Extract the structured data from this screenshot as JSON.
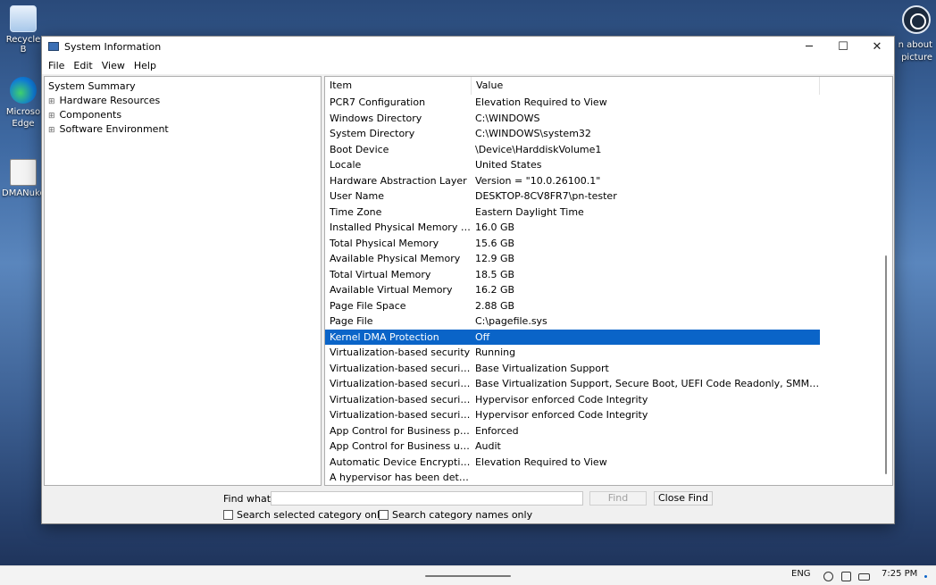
{
  "desktop": {
    "icons": [
      {
        "label": "Recycle B"
      },
      {
        "label": "Microso\nEdge"
      },
      {
        "label": "DMANuke"
      }
    ],
    "spotlight_text": "n about\npicture"
  },
  "window": {
    "title": "System Information",
    "controls": {
      "minimize": "─",
      "maximize": "☐",
      "close": "✕"
    }
  },
  "menu": [
    "File",
    "Edit",
    "View",
    "Help"
  ],
  "tree": [
    {
      "label": "System Summary",
      "expander": ""
    },
    {
      "label": "Hardware Resources",
      "expander": "⊞"
    },
    {
      "label": "Components",
      "expander": "⊞"
    },
    {
      "label": "Software Environment",
      "expander": "⊞"
    }
  ],
  "list": {
    "headers": [
      "Item",
      "Value"
    ],
    "rows": [
      {
        "item": "PCR7 Configuration",
        "value": "Elevation Required to View"
      },
      {
        "item": "Windows Directory",
        "value": "C:\\WINDOWS"
      },
      {
        "item": "System Directory",
        "value": "C:\\WINDOWS\\system32"
      },
      {
        "item": "Boot Device",
        "value": "\\Device\\HarddiskVolume1"
      },
      {
        "item": "Locale",
        "value": "United States"
      },
      {
        "item": "Hardware Abstraction Layer",
        "value": "Version = \"10.0.26100.1\""
      },
      {
        "item": "User Name",
        "value": "DESKTOP-8CV8FR7\\pn-tester"
      },
      {
        "item": "Time Zone",
        "value": "Eastern Daylight Time"
      },
      {
        "item": "Installed Physical Memory (RAM)",
        "value": "16.0 GB"
      },
      {
        "item": "Total Physical Memory",
        "value": "15.6 GB"
      },
      {
        "item": "Available Physical Memory",
        "value": "12.9 GB"
      },
      {
        "item": "Total Virtual Memory",
        "value": "18.5 GB"
      },
      {
        "item": "Available Virtual Memory",
        "value": "16.2 GB"
      },
      {
        "item": "Page File Space",
        "value": "2.88 GB"
      },
      {
        "item": "Page File",
        "value": "C:\\pagefile.sys"
      },
      {
        "item": "Kernel DMA Protection",
        "value": "Off"
      },
      {
        "item": "Virtualization-based security",
        "value": "Running"
      },
      {
        "item": "Virtualization-based security Re...",
        "value": "Base Virtualization Support"
      },
      {
        "item": "Virtualization-based security Av...",
        "value": "Base Virtualization Support, Secure Boot, UEFI Code Readonly, SMM Security ..."
      },
      {
        "item": "Virtualization-based security Se...",
        "value": "Hypervisor enforced Code Integrity"
      },
      {
        "item": "Virtualization-based security Se...",
        "value": "Hypervisor enforced Code Integrity"
      },
      {
        "item": "App Control for Business policy",
        "value": "Enforced"
      },
      {
        "item": "App Control for Business user m...",
        "value": "Audit"
      },
      {
        "item": "Automatic Device Encryption Su...",
        "value": "Elevation Required to View"
      },
      {
        "item": "A hypervisor has been detected....",
        "value": ""
      }
    ],
    "selected_item": "Kernel DMA Protection"
  },
  "find": {
    "label": "Find what:",
    "value": "",
    "find_button": "Find",
    "close_button": "Close Find",
    "check_selected": "Search selected category only",
    "check_names": "Search category names only"
  },
  "taskbar": {
    "language": "ENG",
    "time": "7:25 PM"
  },
  "colors": {
    "selection": "#0a64c8"
  }
}
